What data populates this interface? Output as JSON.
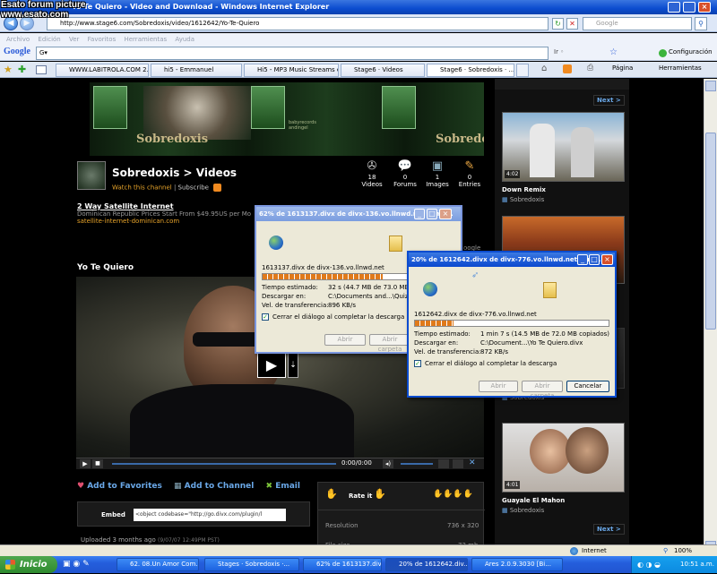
{
  "watermark": {
    "line1": "Esato forum picture",
    "line2": "www.esato.com"
  },
  "window": {
    "title": "Yo Te Quiero - Video and Download - Windows Internet Explorer"
  },
  "address": {
    "url": "http://www.stage6.com/Sobredoxis/video/1612642/Yo-Te-Quiero",
    "search_placeholder": "Google"
  },
  "menu": [
    "Archivo",
    "Edición",
    "Ver",
    "Favoritos",
    "Herramientas",
    "Ayuda"
  ],
  "googlebar": {
    "label": "Google",
    "config": "Configuración"
  },
  "tabs": [
    "WWW.LABITROLA.COM 2.0",
    "hi5 - Emmanuel",
    "Hi5 - MP3 Music Streams o...",
    "Stage6 · Videos",
    "Stage6 · Sobredoxis · ..."
  ],
  "tools": {
    "pagina": "Página",
    "herramientas": "Herramientas"
  },
  "banner": {
    "brand": "Sobredoxis",
    "small": "babyrecords\nandingel"
  },
  "channel": {
    "title": "Sobredoxis > Videos",
    "watch": "Watch this channel",
    "subscribe": "Subscribe"
  },
  "stats": [
    {
      "num": "18",
      "label": "Videos"
    },
    {
      "num": "0",
      "label": "Forums"
    },
    {
      "num": "1",
      "label": "Images"
    },
    {
      "num": "0",
      "label": "Entries"
    }
  ],
  "ad": {
    "title": "2 Way Satellite Internet",
    "text": "Dominican Republic Prices Start From $49.95US per Mo",
    "url": "satellite-internet-dominican.com",
    "google": "oogle"
  },
  "video": {
    "title": "Yo Te Quiero",
    "time": "0:00/0:00"
  },
  "actions": {
    "favorites": "Add to Favorites",
    "channel": "Add to Channel",
    "email": "Email"
  },
  "embed": {
    "label": "Embed",
    "code": "<object codebase=\"http://go.divx.com/plugin/l"
  },
  "uploaded": {
    "text": "Uploaded 3 months ago",
    "date": "(9/07/07 12:49PM PST)"
  },
  "rate": {
    "label": "Rate it"
  },
  "details": {
    "res_label": "Resolution",
    "res_value": "736 x 320",
    "size_label": "File size",
    "size_value": "73 mb"
  },
  "sidebar": {
    "next": "Next >",
    "next2": "Next >",
    "items": [
      {
        "time": "4:02",
        "title": "Down Remix",
        "author": "Sobredoxis"
      },
      {
        "time": "",
        "title": "",
        "author": "Sobredoxis"
      },
      {
        "time": "",
        "title": "",
        "author": "Sobredoxis"
      },
      {
        "time": "4:01",
        "title": "Guayale El Mahon",
        "author": "Sobredoxis"
      }
    ]
  },
  "dialog1": {
    "title": "62% de 1613137.divx de divx-136.vo.llnwd.net comp...",
    "file": "1613137.divx de divx-136.vo.llnwd.net",
    "progress": 62,
    "label_time": "Tiempo estimado:",
    "value_time": "32 s (44.7 MB de 73.0 MB copiad",
    "label_dest": "Descargar en:",
    "value_dest": "C:\\Documents and...\\Quizas.d",
    "label_rate": "Vel. de transferencia:",
    "value_rate": "896 KB/s",
    "checkbox": "Cerrar el diálogo al completar la descarga",
    "btn_open": "Abrir",
    "btn_folder": "Abrir carpeta"
  },
  "dialog2": {
    "title": "20% de 1612642.divx de divx-776.vo.llnwd.net comp...",
    "file": "1612642.divx de divx-776.vo.llnwd.net",
    "progress": 20,
    "label_time": "Tiempo estimado:",
    "value_time": "1 min 7 s (14.5 MB de 72.0 MB copiados)",
    "label_dest": "Descargar en:",
    "value_dest": "C:\\Document...\\Yo Te Quiero.divx",
    "label_rate": "Vel. de transferencia:",
    "value_rate": "872 KB/s",
    "checkbox": "Cerrar el diálogo al completar la descarga",
    "btn_open": "Abrir",
    "btn_folder": "Abrir carpeta",
    "btn_cancel": "Cancelar"
  },
  "status": {
    "zone": "Internet",
    "zoom": "100%"
  },
  "taskbar": {
    "start": "Inicio",
    "items": [
      "62. 08.Un Amor Com...",
      "Stages · Sobredoxis ·...",
      "62% de 1613137.div...",
      "20% de 1612642.div...",
      "Ares 2.0.9.3030 [Bi..."
    ],
    "clock": "10:51 a.m."
  }
}
